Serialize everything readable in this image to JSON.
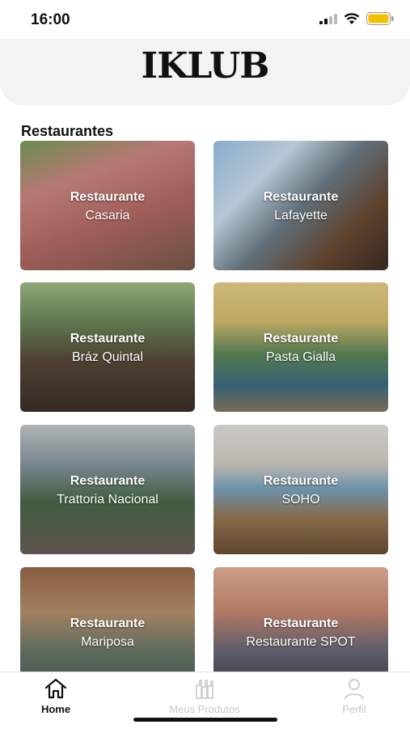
{
  "status": {
    "time": "16:00",
    "battery_color": "#f2c200"
  },
  "header": {
    "logo": "IKLUB"
  },
  "section_title": "Restaurantes",
  "restaurants": [
    {
      "line1": "Restaurante",
      "line2": "Casaria"
    },
    {
      "line1": "Restaurante",
      "line2": "Lafayette"
    },
    {
      "line1": "Restaurante",
      "line2": "Bráz Quintal"
    },
    {
      "line1": "Restaurante",
      "line2": "Pasta Gialla"
    },
    {
      "line1": "Restaurante",
      "line2": "Trattoria Nacional"
    },
    {
      "line1": "Restaurante",
      "line2": "SOHO"
    },
    {
      "line1": "Restaurante",
      "line2": "Mariposa"
    },
    {
      "line1": "Restaurante",
      "line2": "Restaurante SPOT"
    }
  ],
  "tabbar": {
    "home": "Home",
    "products": "Meus Produtos",
    "profile": "Perfil",
    "active_color": "#111111",
    "inactive_color": "#c8c8c8"
  }
}
